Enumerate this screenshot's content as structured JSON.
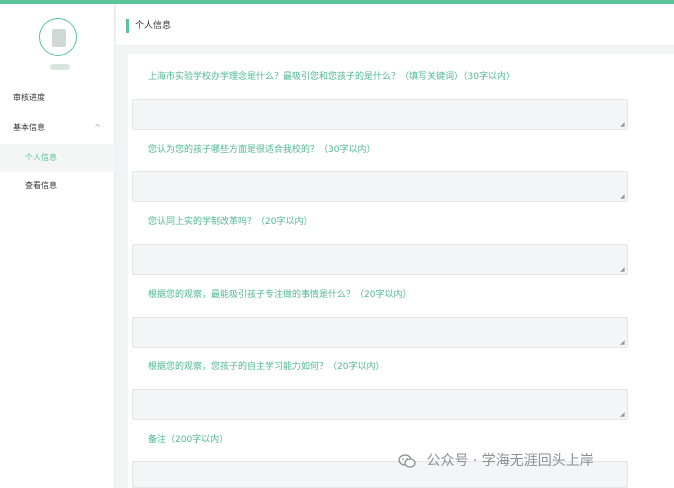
{
  "sidebar": {
    "nav": [
      {
        "label": "审核进度",
        "level": 0,
        "active": false
      },
      {
        "label": "基本信息",
        "level": 0,
        "active": false,
        "expandable": true,
        "expanded": true,
        "chevron": "^"
      },
      {
        "label": "个人信息",
        "level": 1,
        "active": true
      },
      {
        "label": "查看信息",
        "level": 1,
        "active": false
      }
    ]
  },
  "header": {
    "title": "个人信息"
  },
  "form": {
    "questions": [
      {
        "label": "上海市实验学校办学理念是什么？最吸引您和您孩子的是什么？（填写关键词）（30字以内）",
        "value": ""
      },
      {
        "label": "您认为您的孩子哪些方面是很适合我校的？（30字以内）",
        "value": ""
      },
      {
        "label": "您认同上实的学制改革吗？（20字以内）",
        "value": ""
      },
      {
        "label": "根据您的观察，最能吸引孩子专注做的事情是什么？（20字以内）",
        "value": ""
      },
      {
        "label": "根据您的观察，您孩子的自主学习能力如何？（20字以内）",
        "value": ""
      },
      {
        "label": "备注（200字以内）",
        "value": ""
      }
    ]
  },
  "watermark": {
    "text": "公众号 · 学海无涯回头上岸",
    "icon": "wechat-icon"
  },
  "colors": {
    "accent": "#5bc49a",
    "label": "#4fb890",
    "input_bg": "#f3f5f7"
  }
}
